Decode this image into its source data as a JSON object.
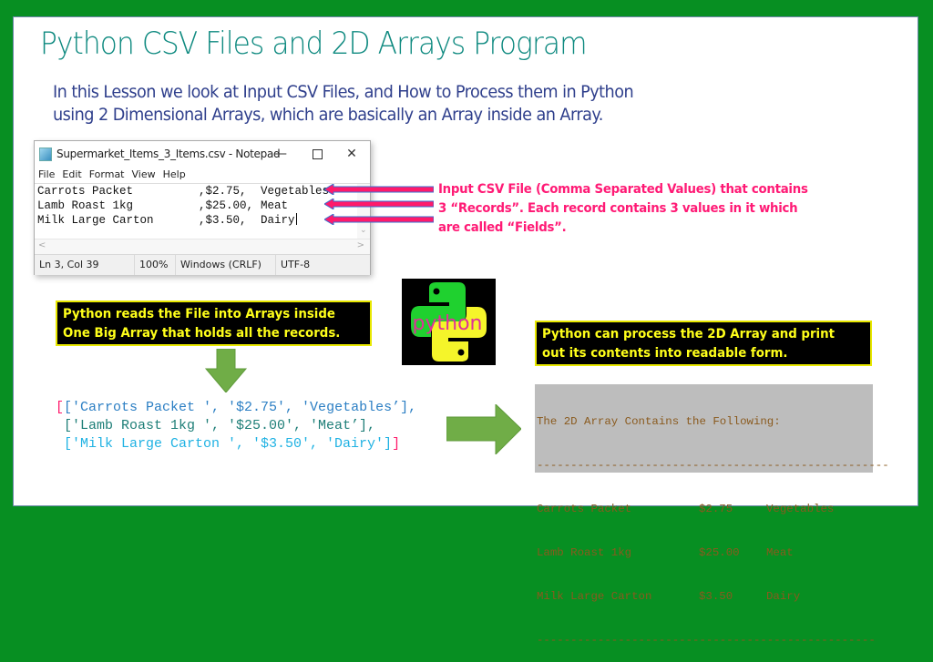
{
  "slide": {
    "title": "Python CSV Files and 2D Arrays Program",
    "subtitle_lines": [
      "In this Lesson we look at Input CSV Files, and How to Process them in Python",
      "using 2 Dimensional Arrays, which are basically an Array inside an Array."
    ],
    "colors": {
      "border_green": "#078f22",
      "title_teal": "#0f8a80",
      "subtitle_navy": "#2f3f8c",
      "annotation_pink": "#ff1a75",
      "callout_yellow": "#ffff1a",
      "arrow_green": "#70ad47"
    }
  },
  "notepad": {
    "window_title": "Supermarket_Items_3_Items.csv - Notepad",
    "controls": {
      "minimize": "—",
      "close": "✕"
    },
    "menu": [
      "File",
      "Edit",
      "Format",
      "View",
      "Help"
    ],
    "lines": [
      {
        "name": "Carrots Packet",
        "price": ",$2.75,",
        "category": "Vegetables"
      },
      {
        "name": "Lamb Roast 1kg",
        "price": ",$25.00,",
        "category": "Meat"
      },
      {
        "name": "Milk Large Carton",
        "price": ",$3.50,",
        "category": "Dairy"
      }
    ],
    "scroll": {
      "down": "⌄",
      "left": "<",
      "right": ">"
    },
    "status": {
      "position": "Ln 3, Col 39",
      "zoom": "100%",
      "line_ending": "Windows (CRLF)",
      "encoding": "UTF-8"
    }
  },
  "annotation": {
    "lines": [
      "Input CSV File (Comma Separated Values) that contains",
      "3 “Records”. Each record contains 3 values in it which",
      "are called “Fields”."
    ]
  },
  "callout_left": {
    "lines": [
      "Python reads the File into Arrays inside",
      "One Big Array that holds all the records."
    ]
  },
  "python_logo": {
    "label": "python"
  },
  "callout_right": {
    "lines": [
      "Python can process the 2D Array and print",
      "out its contents into readable form."
    ]
  },
  "array_code": {
    "open": "[",
    "close": "]",
    "rows": [
      "['Carrots Packet ', '$2.75', 'Vegetables’],",
      " ['Lamb Roast 1kg ', '$25.00', 'Meat’],",
      " ['Milk Large Carton ', '$3.50', 'Dairy']"
    ]
  },
  "console": {
    "heading": "The 2D Array Contains the Following:",
    "separator_top": "----------------------------------------------------",
    "rows": [
      {
        "name": "Carrots Packet",
        "price": "$2.75",
        "category": "Vegetables"
      },
      {
        "name": "Lamb Roast 1kg",
        "price": "$25.00",
        "category": "Meat"
      },
      {
        "name": "Milk Large Carton",
        "price": "$3.50",
        "category": "Dairy"
      }
    ],
    "separator_bottom": "--------------------------------------------------"
  }
}
